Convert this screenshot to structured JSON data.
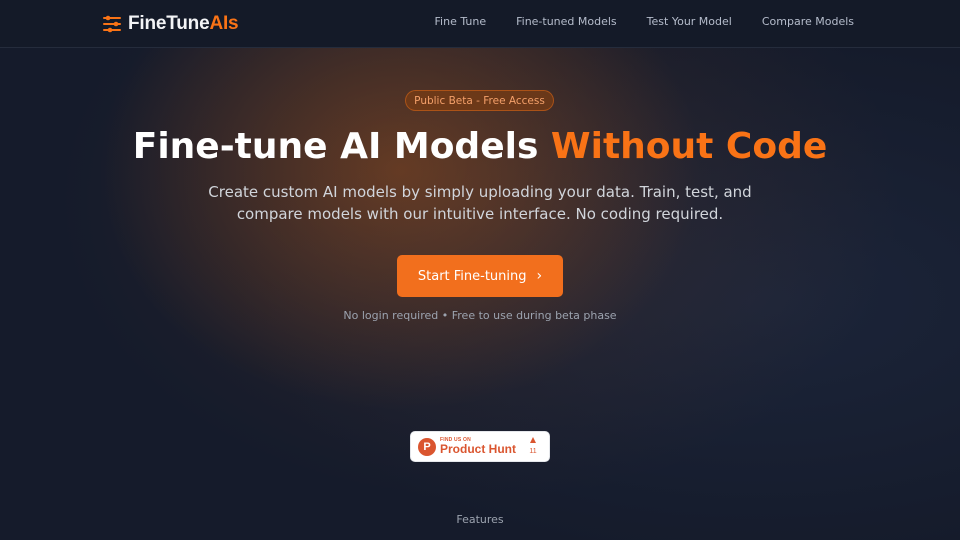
{
  "brand": {
    "name_part1": "FineTune",
    "name_part2": "AIs",
    "accent_color": "#f97316"
  },
  "nav": {
    "links": [
      "Fine Tune",
      "Fine-tuned Models",
      "Test Your Model",
      "Compare Models"
    ]
  },
  "hero": {
    "badge": "Public Beta - Free Access",
    "title_plain": "Fine-tune AI Models ",
    "title_accent": "Without Code",
    "subtitle_line1": "Create custom AI models by simply uploading your data. Train, test, and",
    "subtitle_line2": "compare models with our intuitive interface. No coding required.",
    "cta_label": "Start Fine-tuning",
    "cta_icon": "chevron-right-icon",
    "note": "No login required • Free to use during beta phase"
  },
  "product_hunt": {
    "logo_letter": "P",
    "small_text": "FIND US ON",
    "big_text": "Product Hunt",
    "votes": "11"
  },
  "footer_section": {
    "label": "Features"
  }
}
